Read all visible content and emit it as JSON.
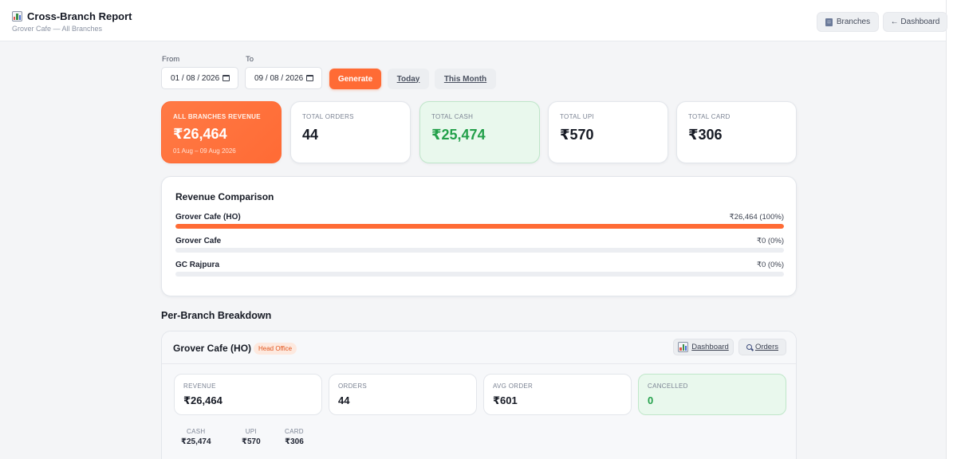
{
  "header": {
    "title": "Cross-Branch Report",
    "subtitle": "Grover Cafe — All Branches",
    "branches_label": "Branches",
    "dashboard_label": "← Dashboard"
  },
  "filters": {
    "from_label": "From",
    "to_label": "To",
    "from_value": "01 / 08 / 2026",
    "to_value": "09 / 08 / 2026",
    "generate_label": "Generate",
    "today_label": "Today",
    "this_month_label": "This Month"
  },
  "summary": {
    "revenue_label": "ALL BRANCHES REVENUE",
    "revenue_value": "₹26,464",
    "revenue_range": "01 Aug – 09 Aug 2026",
    "orders_label": "TOTAL ORDERS",
    "orders_value": "44",
    "cash_label": "TOTAL CASH",
    "cash_value": "₹25,474",
    "upi_label": "TOTAL UPI",
    "upi_value": "₹570",
    "card_label": "TOTAL CARD",
    "card_value": "₹306"
  },
  "comparison": {
    "title": "Revenue Comparison",
    "rows": [
      {
        "name": "Grover Cafe (HO)",
        "amount": "₹26,464 (100%)",
        "share": 100
      },
      {
        "name": "Grover Cafe",
        "amount": "₹0 (0%)",
        "share": 0
      },
      {
        "name": "GC Rajpura",
        "amount": "₹0 (0%)",
        "share": 0
      }
    ]
  },
  "breakdown": {
    "title": "Per-Branch Breakdown",
    "branch": {
      "name": "Grover Cafe (HO)",
      "badge": "Head Office",
      "dashboard_label": "Dashboard",
      "orders_label": "Orders",
      "revenue_label": "REVENUE",
      "revenue_value": "₹26,464",
      "orders_count_label": "ORDERS",
      "orders_count_value": "44",
      "avg_label": "AVG ORDER",
      "avg_value": "₹601",
      "cancelled_label": "CANCELLED",
      "cancelled_value": "0",
      "cash_label": "CASH",
      "cash_value": "₹25,474",
      "upi_label": "UPI",
      "upi_value": "₹570",
      "card_label": "CARD",
      "card_value": "₹306"
    }
  },
  "colors": {
    "accent": "#ff6b35",
    "success": "#23a04a",
    "success_bg": "#e9f8ed"
  },
  "icons": [
    "bar-chart-icon",
    "building-icon",
    "calendar-icon",
    "magnifier-icon"
  ]
}
